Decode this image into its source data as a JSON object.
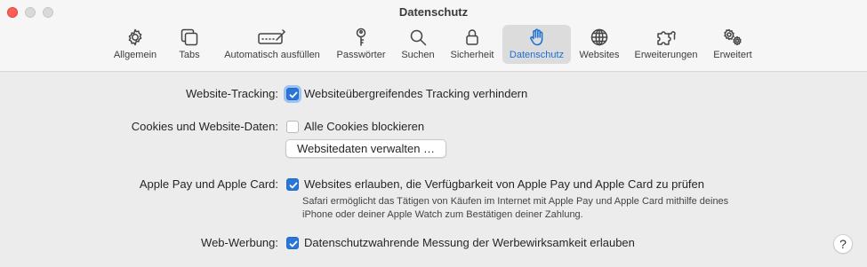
{
  "window": {
    "title": "Datenschutz"
  },
  "toolbar": {
    "tabs": [
      {
        "label": "Allgemein",
        "icon": "gear-icon"
      },
      {
        "label": "Tabs",
        "icon": "tabs-icon"
      },
      {
        "label": "Automatisch ausfüllen",
        "icon": "autofill-icon"
      },
      {
        "label": "Passwörter",
        "icon": "key-icon"
      },
      {
        "label": "Suchen",
        "icon": "magnifier-icon"
      },
      {
        "label": "Sicherheit",
        "icon": "lock-icon"
      },
      {
        "label": "Datenschutz",
        "icon": "hand-icon",
        "active": true
      },
      {
        "label": "Websites",
        "icon": "globe-icon"
      },
      {
        "label": "Erweiterungen",
        "icon": "puzzle-icon"
      },
      {
        "label": "Erweitert",
        "icon": "gears-icon"
      }
    ]
  },
  "settings": {
    "tracking": {
      "label": "Website-Tracking:",
      "option": "Websiteübergreifendes Tracking verhindern",
      "checked": true
    },
    "cookies": {
      "label": "Cookies und Website-Daten:",
      "option": "Alle Cookies blockieren",
      "checked": false,
      "button": "Websitedaten verwalten …"
    },
    "applepay": {
      "label": "Apple Pay und Apple Card:",
      "option": "Websites erlauben, die Verfügbarkeit von Apple Pay und Apple Card zu prüfen",
      "checked": true,
      "description": "Safari ermöglicht das Tätigen von Käufen im Internet mit Apple Pay und Apple Card mithilfe deines iPhone oder deiner Apple Watch zum Bestätigen deiner Zahlung."
    },
    "adv": {
      "label": "Web-Werbung:",
      "option": "Datenschutzwahrende Messung der Werbewirksamkeit erlauben",
      "checked": true
    }
  },
  "help": {
    "label": "?"
  },
  "colors": {
    "accent": "#2a76d8",
    "active_label": "#1a6fd6"
  }
}
